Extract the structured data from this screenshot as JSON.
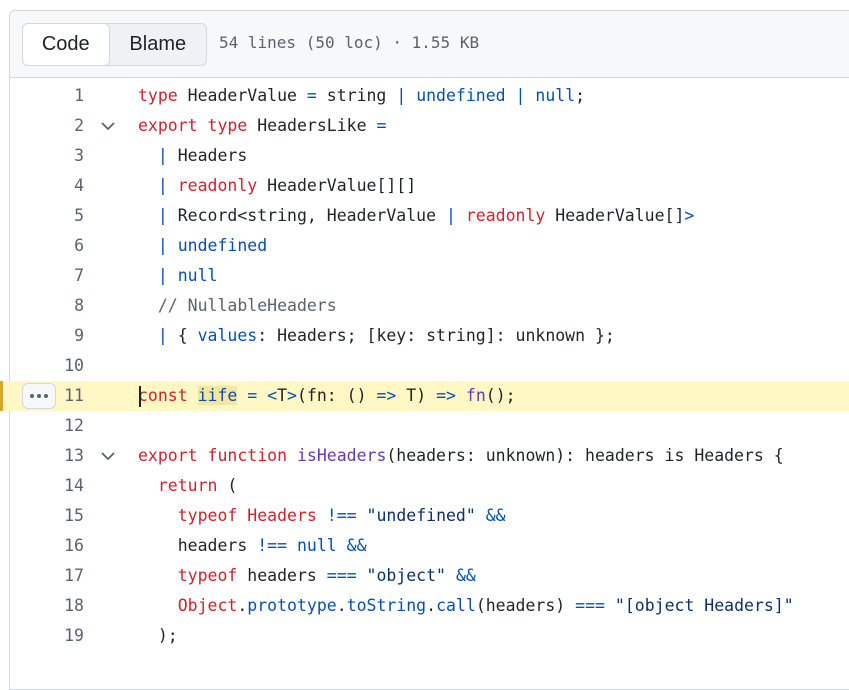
{
  "tabs": {
    "code_label": "Code",
    "blame_label": "Blame"
  },
  "file_meta": "54 lines (50 loc) · 1.55 KB",
  "colors": {
    "keyword": "#cf222e",
    "constant": "#0550ae",
    "function": "#6639ba",
    "string": "#0a3069",
    "comment": "#59636e",
    "highlight": "#fff8c5"
  },
  "icons": {
    "fold": "chevron-down-icon",
    "more": "kebab-horizontal-icon"
  },
  "highlighted_line": 11,
  "lines": [
    {
      "n": "1",
      "fold": false,
      "tokens": [
        [
          "k",
          "type"
        ],
        [
          "p",
          " HeaderValue "
        ],
        [
          "b",
          "="
        ],
        [
          "p",
          " string "
        ],
        [
          "b",
          "|"
        ],
        [
          "p",
          " "
        ],
        [
          "b",
          "undefined"
        ],
        [
          "p",
          " "
        ],
        [
          "b",
          "|"
        ],
        [
          "p",
          " "
        ],
        [
          "b",
          "null"
        ],
        [
          "p",
          ";"
        ]
      ]
    },
    {
      "n": "2",
      "fold": true,
      "tokens": [
        [
          "k",
          "export"
        ],
        [
          "p",
          " "
        ],
        [
          "k",
          "type"
        ],
        [
          "p",
          " HeadersLike "
        ],
        [
          "b",
          "="
        ]
      ]
    },
    {
      "n": "3",
      "fold": false,
      "tokens": [
        [
          "p",
          "  "
        ],
        [
          "b",
          "|"
        ],
        [
          "p",
          " Headers"
        ]
      ]
    },
    {
      "n": "4",
      "fold": false,
      "tokens": [
        [
          "p",
          "  "
        ],
        [
          "b",
          "|"
        ],
        [
          "p",
          " "
        ],
        [
          "k",
          "readonly"
        ],
        [
          "p",
          " HeaderValue[][]"
        ]
      ]
    },
    {
      "n": "5",
      "fold": false,
      "tokens": [
        [
          "p",
          "  "
        ],
        [
          "b",
          "|"
        ],
        [
          "p",
          " Record<string, HeaderValue "
        ],
        [
          "b",
          "|"
        ],
        [
          "p",
          " "
        ],
        [
          "k",
          "readonly"
        ],
        [
          "p",
          " HeaderValue[]"
        ],
        [
          "b",
          ">"
        ]
      ]
    },
    {
      "n": "6",
      "fold": false,
      "tokens": [
        [
          "p",
          "  "
        ],
        [
          "b",
          "|"
        ],
        [
          "p",
          " "
        ],
        [
          "b",
          "undefined"
        ]
      ]
    },
    {
      "n": "7",
      "fold": false,
      "tokens": [
        [
          "p",
          "  "
        ],
        [
          "b",
          "|"
        ],
        [
          "p",
          " "
        ],
        [
          "b",
          "null"
        ]
      ]
    },
    {
      "n": "8",
      "fold": false,
      "tokens": [
        [
          "c",
          "  // NullableHeaders"
        ]
      ]
    },
    {
      "n": "9",
      "fold": false,
      "tokens": [
        [
          "p",
          "  "
        ],
        [
          "b",
          "|"
        ],
        [
          "p",
          " { "
        ],
        [
          "b",
          "values"
        ],
        [
          "p",
          ": Headers; [key: string]: unknown };"
        ]
      ]
    },
    {
      "n": "10",
      "fold": false,
      "tokens": []
    },
    {
      "n": "11",
      "fold": false,
      "tokens": [
        [
          "k",
          "const"
        ],
        [
          "p",
          " "
        ],
        [
          "bh",
          "iife"
        ],
        [
          "p",
          " "
        ],
        [
          "b",
          "="
        ],
        [
          "p",
          " "
        ],
        [
          "b",
          "<"
        ],
        [
          "p",
          "T"
        ],
        [
          "b",
          ">"
        ],
        [
          "p",
          "(fn: () "
        ],
        [
          "b",
          "=>"
        ],
        [
          "p",
          " T) "
        ],
        [
          "b",
          "=>"
        ],
        [
          "p",
          " "
        ],
        [
          "f",
          "fn"
        ],
        [
          "p",
          "();"
        ]
      ]
    },
    {
      "n": "12",
      "fold": false,
      "tokens": []
    },
    {
      "n": "13",
      "fold": true,
      "tokens": [
        [
          "k",
          "export"
        ],
        [
          "p",
          " "
        ],
        [
          "k",
          "function"
        ],
        [
          "p",
          " "
        ],
        [
          "f",
          "isHeaders"
        ],
        [
          "p",
          "(headers: unknown): headers is Headers {"
        ]
      ]
    },
    {
      "n": "14",
      "fold": false,
      "tokens": [
        [
          "p",
          "  "
        ],
        [
          "k",
          "return"
        ],
        [
          "p",
          " ("
        ]
      ]
    },
    {
      "n": "15",
      "fold": false,
      "tokens": [
        [
          "p",
          "    "
        ],
        [
          "k",
          "typeof"
        ],
        [
          "p",
          " "
        ],
        [
          "k",
          "Headers"
        ],
        [
          "p",
          " "
        ],
        [
          "b",
          "!=="
        ],
        [
          "p",
          " "
        ],
        [
          "s",
          "\"undefined\""
        ],
        [
          "p",
          " "
        ],
        [
          "b",
          "&&"
        ]
      ]
    },
    {
      "n": "16",
      "fold": false,
      "tokens": [
        [
          "p",
          "    headers "
        ],
        [
          "b",
          "!=="
        ],
        [
          "p",
          " "
        ],
        [
          "b",
          "null"
        ],
        [
          "p",
          " "
        ],
        [
          "b",
          "&&"
        ]
      ]
    },
    {
      "n": "17",
      "fold": false,
      "tokens": [
        [
          "p",
          "    "
        ],
        [
          "k",
          "typeof"
        ],
        [
          "p",
          " headers "
        ],
        [
          "b",
          "==="
        ],
        [
          "p",
          " "
        ],
        [
          "s",
          "\"object\""
        ],
        [
          "p",
          " "
        ],
        [
          "b",
          "&&"
        ]
      ]
    },
    {
      "n": "18",
      "fold": false,
      "tokens": [
        [
          "p",
          "    "
        ],
        [
          "k",
          "Object"
        ],
        [
          "p",
          "."
        ],
        [
          "b",
          "prototype"
        ],
        [
          "p",
          "."
        ],
        [
          "b",
          "toString"
        ],
        [
          "p",
          "."
        ],
        [
          "b",
          "call"
        ],
        [
          "p",
          "(headers) "
        ],
        [
          "b",
          "==="
        ],
        [
          "p",
          " "
        ],
        [
          "s",
          "\"[object Headers]\""
        ]
      ]
    },
    {
      "n": "19",
      "fold": false,
      "tokens": [
        [
          "p",
          "  );"
        ]
      ]
    }
  ]
}
